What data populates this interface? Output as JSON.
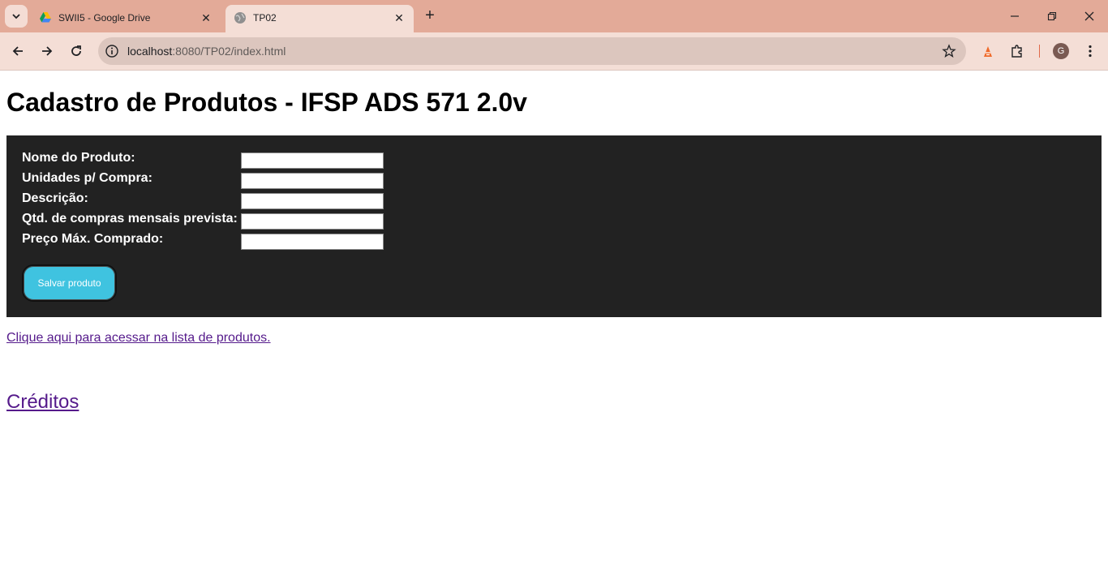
{
  "browser": {
    "tabs": [
      {
        "title": "SWII5 - Google Drive",
        "active": false
      },
      {
        "title": "TP02",
        "active": true
      }
    ],
    "address": {
      "host": "localhost",
      "rest": ":8080/TP02/index.html"
    },
    "profile_initial": "G",
    "colors": {
      "tabstrip": "#e3aa98",
      "toolbar": "#f4ded6",
      "omnibox": "#dcc6be"
    }
  },
  "page": {
    "title": "Cadastro de Produtos - IFSP ADS 571 2.0v",
    "form": {
      "fields": [
        {
          "label": "Nome do Produto:",
          "value": ""
        },
        {
          "label": "Unidades p/ Compra:",
          "value": ""
        },
        {
          "label": "Descrição:",
          "value": ""
        },
        {
          "label": "Qtd. de compras mensais prevista:",
          "value": ""
        },
        {
          "label": "Preço Máx. Comprado:",
          "value": ""
        }
      ],
      "save_label": "Salvar produto",
      "colors": {
        "panel": "#222222",
        "button": "#3fc3e0"
      }
    },
    "list_link": "Clique aqui para acessar na lista de produtos.",
    "credits_link": "Créditos"
  }
}
